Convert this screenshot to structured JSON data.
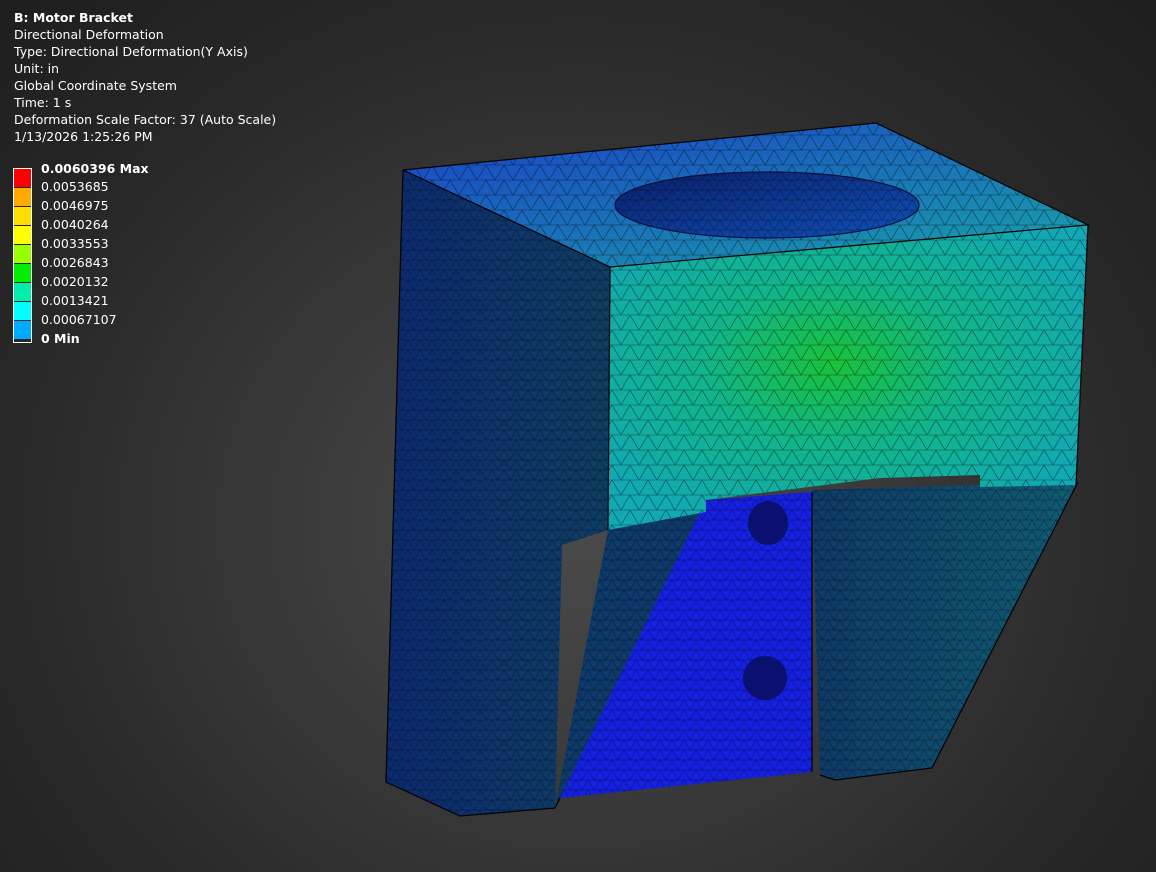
{
  "info": {
    "title": "B: Motor Bracket",
    "result_name": "Directional Deformation",
    "type": "Type: Directional Deformation(Y Axis)",
    "unit": "Unit: in",
    "coordinate_system": "Global Coordinate System",
    "time": "Time: 1 s",
    "scale_factor": "Deformation Scale Factor: 37 (Auto Scale)",
    "timestamp": "1/13/2026 1:25:26 PM"
  },
  "legend": {
    "labels": [
      "0.0060396 Max",
      "0.0053685",
      "0.0046975",
      "0.0040264",
      "0.0033553",
      "0.0026843",
      "0.0020132",
      "0.0013421",
      "0.00067107",
      "0 Min"
    ],
    "colors": [
      "#ff0000",
      "#ffaa00",
      "#ffdd00",
      "#ffff00",
      "#99ff00",
      "#00ee00",
      "#00eeaa",
      "#00ffff",
      "#00aaff",
      "#0000ff"
    ]
  }
}
